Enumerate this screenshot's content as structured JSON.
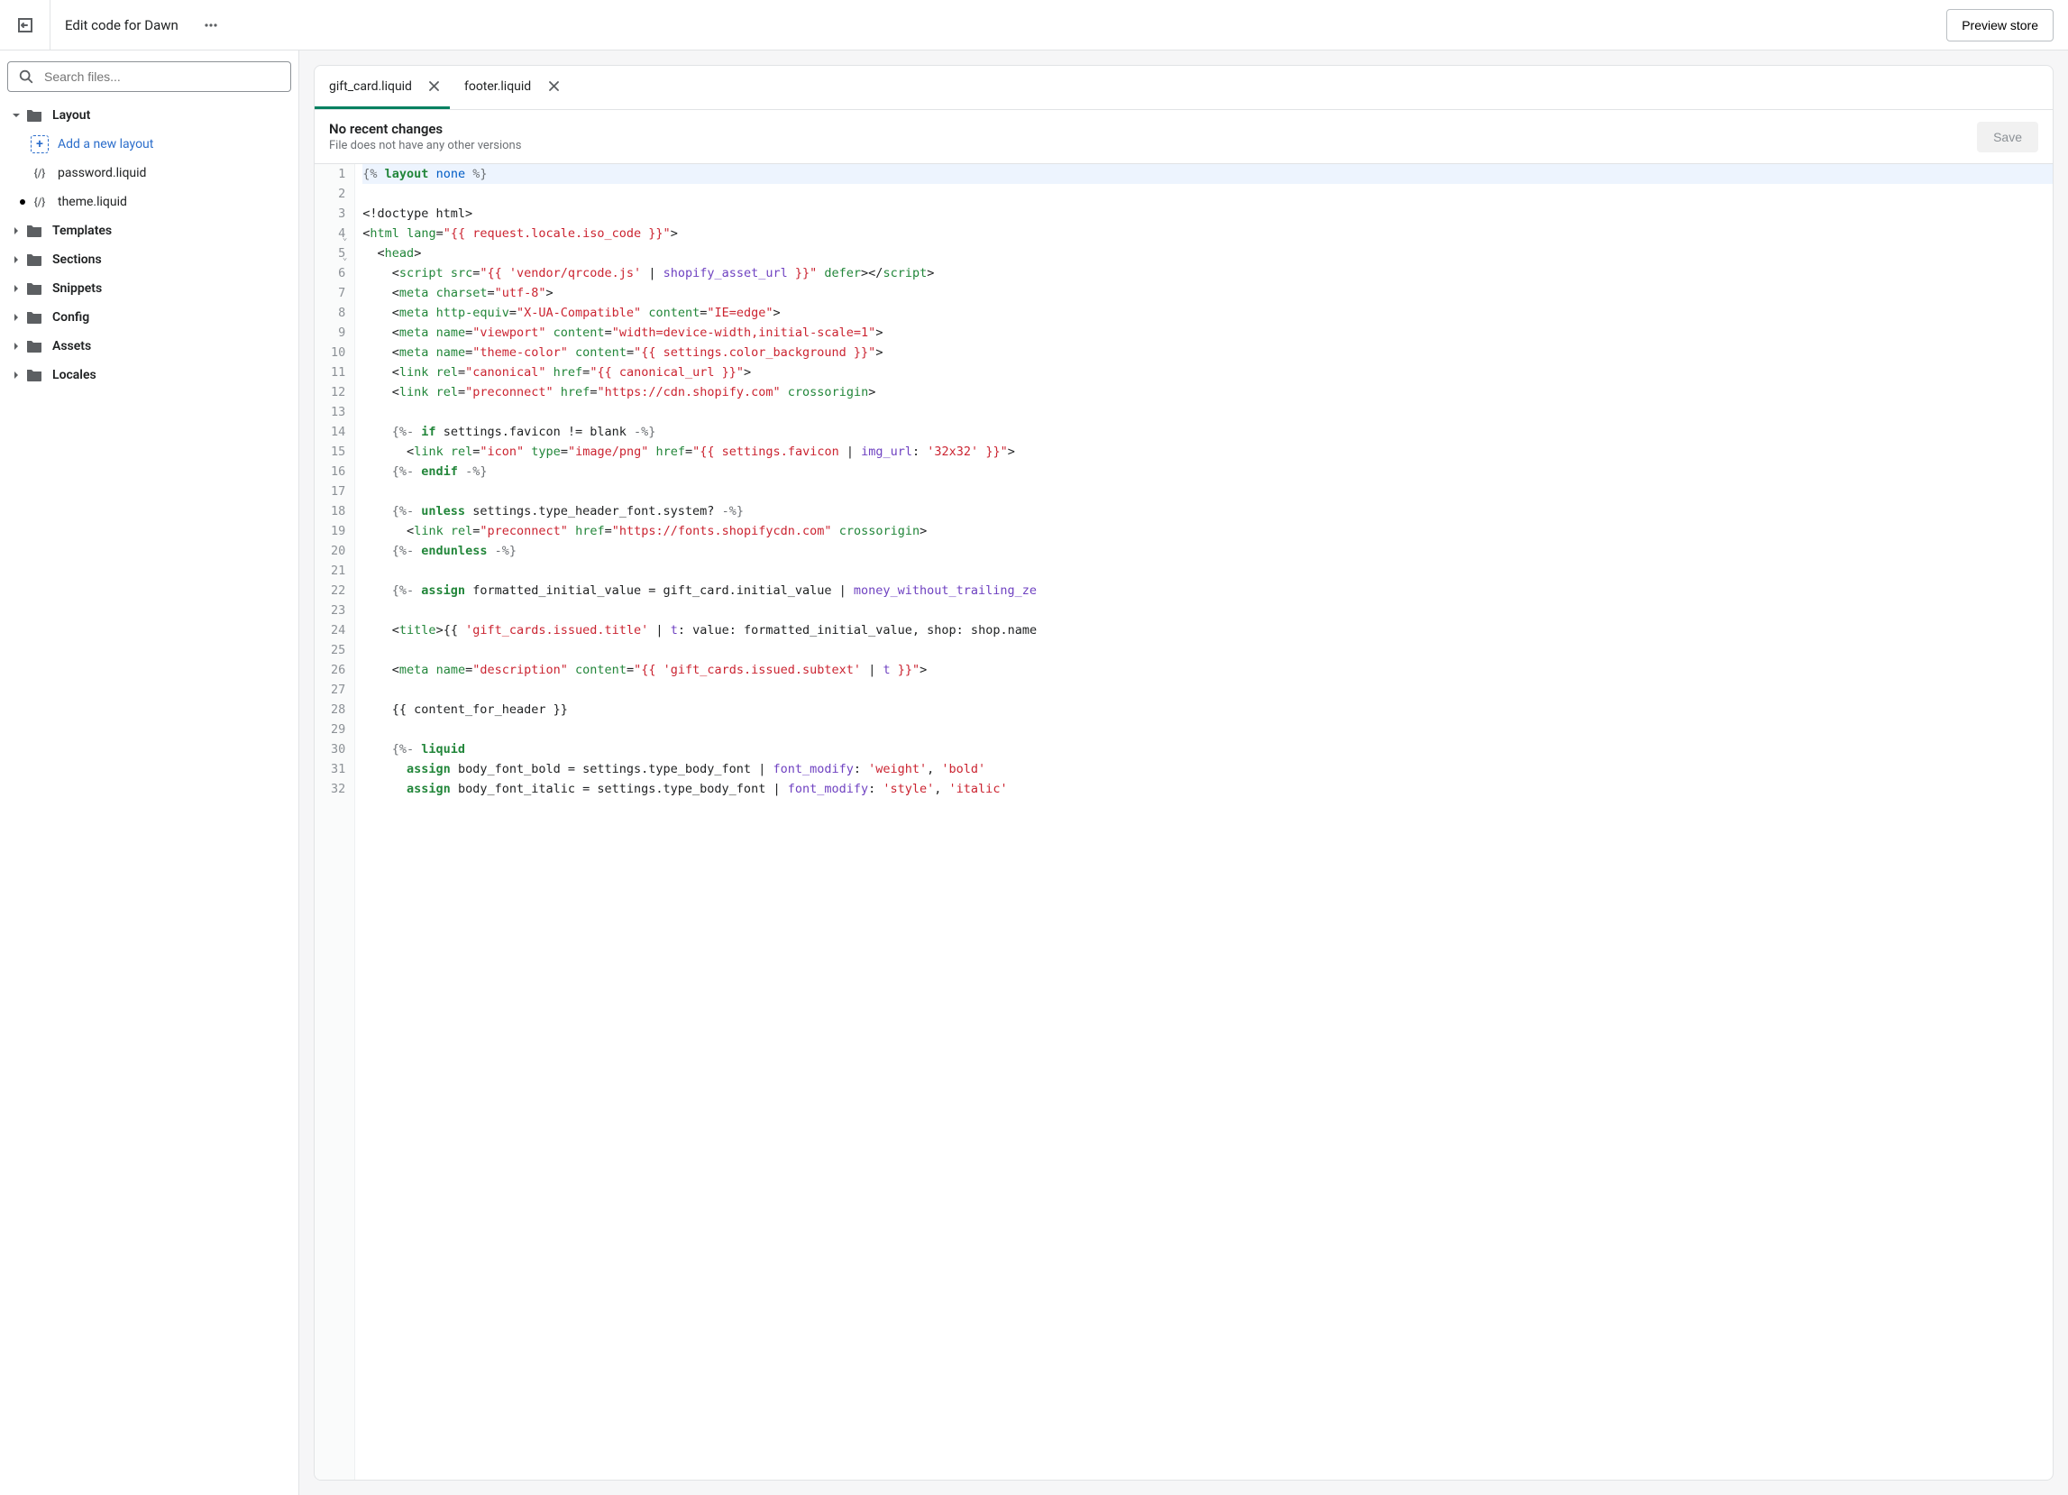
{
  "header": {
    "title": "Edit code for Dawn",
    "preview_label": "Preview store"
  },
  "sidebar": {
    "search_placeholder": "Search files...",
    "folders": [
      {
        "name": "Layout",
        "expanded": true
      },
      {
        "name": "Templates",
        "expanded": false
      },
      {
        "name": "Sections",
        "expanded": false
      },
      {
        "name": "Snippets",
        "expanded": false
      },
      {
        "name": "Config",
        "expanded": false
      },
      {
        "name": "Assets",
        "expanded": false
      },
      {
        "name": "Locales",
        "expanded": false
      }
    ],
    "layout_children": {
      "add_label": "Add a new layout",
      "files": [
        {
          "name": "password.liquid",
          "modified": false
        },
        {
          "name": "theme.liquid",
          "modified": true
        }
      ]
    }
  },
  "tabs": [
    {
      "label": "gift_card.liquid",
      "active": true
    },
    {
      "label": "footer.liquid",
      "active": false
    }
  ],
  "changes": {
    "title": "No recent changes",
    "subtitle": "File does not have any other versions",
    "save_label": "Save"
  },
  "code": {
    "line_count": 32,
    "fold_lines": [
      4,
      5
    ],
    "lines": [
      [
        {
          "c": "t-delim",
          "t": "{% "
        },
        {
          "c": "t-kw",
          "t": "layout"
        },
        {
          "c": "t-plain",
          "t": " "
        },
        {
          "c": "t-none",
          "t": "none"
        },
        {
          "c": "t-delim",
          "t": " %}"
        }
      ],
      [],
      [
        {
          "c": "t-tagbr",
          "t": "<!doctype html>"
        }
      ],
      [
        {
          "c": "t-tagbr",
          "t": "<"
        },
        {
          "c": "t-tag",
          "t": "html"
        },
        {
          "c": "t-plain",
          "t": " "
        },
        {
          "c": "t-attr",
          "t": "lang"
        },
        {
          "c": "t-plain",
          "t": "="
        },
        {
          "c": "t-str",
          "t": "\"{{ request.locale.iso_code }}\""
        },
        {
          "c": "t-tagbr",
          "t": ">"
        }
      ],
      [
        {
          "c": "t-plain",
          "t": "  "
        },
        {
          "c": "t-tagbr",
          "t": "<"
        },
        {
          "c": "t-tag",
          "t": "head"
        },
        {
          "c": "t-tagbr",
          "t": ">"
        }
      ],
      [
        {
          "c": "t-plain",
          "t": "    "
        },
        {
          "c": "t-tagbr",
          "t": "<"
        },
        {
          "c": "t-tag",
          "t": "script"
        },
        {
          "c": "t-plain",
          "t": " "
        },
        {
          "c": "t-attr",
          "t": "src"
        },
        {
          "c": "t-plain",
          "t": "="
        },
        {
          "c": "t-str",
          "t": "\"{{ 'vendor/qrcode.js' "
        },
        {
          "c": "t-plain",
          "t": "| "
        },
        {
          "c": "t-filter",
          "t": "shopify_asset_url"
        },
        {
          "c": "t-str",
          "t": " }}\""
        },
        {
          "c": "t-plain",
          "t": " "
        },
        {
          "c": "t-attr",
          "t": "defer"
        },
        {
          "c": "t-tagbr",
          "t": "></"
        },
        {
          "c": "t-tag",
          "t": "script"
        },
        {
          "c": "t-tagbr",
          "t": ">"
        }
      ],
      [
        {
          "c": "t-plain",
          "t": "    "
        },
        {
          "c": "t-tagbr",
          "t": "<"
        },
        {
          "c": "t-tag",
          "t": "meta"
        },
        {
          "c": "t-plain",
          "t": " "
        },
        {
          "c": "t-attr",
          "t": "charset"
        },
        {
          "c": "t-plain",
          "t": "="
        },
        {
          "c": "t-str",
          "t": "\"utf-8\""
        },
        {
          "c": "t-tagbr",
          "t": ">"
        }
      ],
      [
        {
          "c": "t-plain",
          "t": "    "
        },
        {
          "c": "t-tagbr",
          "t": "<"
        },
        {
          "c": "t-tag",
          "t": "meta"
        },
        {
          "c": "t-plain",
          "t": " "
        },
        {
          "c": "t-attr",
          "t": "http-equiv"
        },
        {
          "c": "t-plain",
          "t": "="
        },
        {
          "c": "t-str",
          "t": "\"X-UA-Compatible\""
        },
        {
          "c": "t-plain",
          "t": " "
        },
        {
          "c": "t-attr",
          "t": "content"
        },
        {
          "c": "t-plain",
          "t": "="
        },
        {
          "c": "t-str",
          "t": "\"IE=edge\""
        },
        {
          "c": "t-tagbr",
          "t": ">"
        }
      ],
      [
        {
          "c": "t-plain",
          "t": "    "
        },
        {
          "c": "t-tagbr",
          "t": "<"
        },
        {
          "c": "t-tag",
          "t": "meta"
        },
        {
          "c": "t-plain",
          "t": " "
        },
        {
          "c": "t-attr",
          "t": "name"
        },
        {
          "c": "t-plain",
          "t": "="
        },
        {
          "c": "t-str",
          "t": "\"viewport\""
        },
        {
          "c": "t-plain",
          "t": " "
        },
        {
          "c": "t-attr",
          "t": "content"
        },
        {
          "c": "t-plain",
          "t": "="
        },
        {
          "c": "t-str",
          "t": "\"width=device-width,initial-scale=1\""
        },
        {
          "c": "t-tagbr",
          "t": ">"
        }
      ],
      [
        {
          "c": "t-plain",
          "t": "    "
        },
        {
          "c": "t-tagbr",
          "t": "<"
        },
        {
          "c": "t-tag",
          "t": "meta"
        },
        {
          "c": "t-plain",
          "t": " "
        },
        {
          "c": "t-attr",
          "t": "name"
        },
        {
          "c": "t-plain",
          "t": "="
        },
        {
          "c": "t-str",
          "t": "\"theme-color\""
        },
        {
          "c": "t-plain",
          "t": " "
        },
        {
          "c": "t-attr",
          "t": "content"
        },
        {
          "c": "t-plain",
          "t": "="
        },
        {
          "c": "t-str",
          "t": "\"{{ settings.color_background }}\""
        },
        {
          "c": "t-tagbr",
          "t": ">"
        }
      ],
      [
        {
          "c": "t-plain",
          "t": "    "
        },
        {
          "c": "t-tagbr",
          "t": "<"
        },
        {
          "c": "t-tag",
          "t": "link"
        },
        {
          "c": "t-plain",
          "t": " "
        },
        {
          "c": "t-attr",
          "t": "rel"
        },
        {
          "c": "t-plain",
          "t": "="
        },
        {
          "c": "t-str",
          "t": "\"canonical\""
        },
        {
          "c": "t-plain",
          "t": " "
        },
        {
          "c": "t-attr",
          "t": "href"
        },
        {
          "c": "t-plain",
          "t": "="
        },
        {
          "c": "t-str",
          "t": "\"{{ canonical_url }}\""
        },
        {
          "c": "t-tagbr",
          "t": ">"
        }
      ],
      [
        {
          "c": "t-plain",
          "t": "    "
        },
        {
          "c": "t-tagbr",
          "t": "<"
        },
        {
          "c": "t-tag",
          "t": "link"
        },
        {
          "c": "t-plain",
          "t": " "
        },
        {
          "c": "t-attr",
          "t": "rel"
        },
        {
          "c": "t-plain",
          "t": "="
        },
        {
          "c": "t-str",
          "t": "\"preconnect\""
        },
        {
          "c": "t-plain",
          "t": " "
        },
        {
          "c": "t-attr",
          "t": "href"
        },
        {
          "c": "t-plain",
          "t": "="
        },
        {
          "c": "t-str",
          "t": "\"https://cdn.shopify.com\""
        },
        {
          "c": "t-plain",
          "t": " "
        },
        {
          "c": "t-attr",
          "t": "crossorigin"
        },
        {
          "c": "t-tagbr",
          "t": ">"
        }
      ],
      [],
      [
        {
          "c": "t-plain",
          "t": "    "
        },
        {
          "c": "t-delim",
          "t": "{%- "
        },
        {
          "c": "t-kw",
          "t": "if"
        },
        {
          "c": "t-plain",
          "t": " settings.favicon != blank "
        },
        {
          "c": "t-delim",
          "t": "-%}"
        }
      ],
      [
        {
          "c": "t-plain",
          "t": "      "
        },
        {
          "c": "t-tagbr",
          "t": "<"
        },
        {
          "c": "t-tag",
          "t": "link"
        },
        {
          "c": "t-plain",
          "t": " "
        },
        {
          "c": "t-attr",
          "t": "rel"
        },
        {
          "c": "t-plain",
          "t": "="
        },
        {
          "c": "t-str",
          "t": "\"icon\""
        },
        {
          "c": "t-plain",
          "t": " "
        },
        {
          "c": "t-attr",
          "t": "type"
        },
        {
          "c": "t-plain",
          "t": "="
        },
        {
          "c": "t-str",
          "t": "\"image/png\""
        },
        {
          "c": "t-plain",
          "t": " "
        },
        {
          "c": "t-attr",
          "t": "href"
        },
        {
          "c": "t-plain",
          "t": "="
        },
        {
          "c": "t-str",
          "t": "\"{{ settings.favicon "
        },
        {
          "c": "t-plain",
          "t": "| "
        },
        {
          "c": "t-filter",
          "t": "img_url"
        },
        {
          "c": "t-plain",
          "t": ": "
        },
        {
          "c": "t-str",
          "t": "'32x32'"
        },
        {
          "c": "t-str",
          "t": " }}\""
        },
        {
          "c": "t-tagbr",
          "t": ">"
        }
      ],
      [
        {
          "c": "t-plain",
          "t": "    "
        },
        {
          "c": "t-delim",
          "t": "{%- "
        },
        {
          "c": "t-kw",
          "t": "endif"
        },
        {
          "c": "t-delim",
          "t": " -%}"
        }
      ],
      [],
      [
        {
          "c": "t-plain",
          "t": "    "
        },
        {
          "c": "t-delim",
          "t": "{%- "
        },
        {
          "c": "t-kw",
          "t": "unless"
        },
        {
          "c": "t-plain",
          "t": " settings.type_header_font.system? "
        },
        {
          "c": "t-delim",
          "t": "-%}"
        }
      ],
      [
        {
          "c": "t-plain",
          "t": "      "
        },
        {
          "c": "t-tagbr",
          "t": "<"
        },
        {
          "c": "t-tag",
          "t": "link"
        },
        {
          "c": "t-plain",
          "t": " "
        },
        {
          "c": "t-attr",
          "t": "rel"
        },
        {
          "c": "t-plain",
          "t": "="
        },
        {
          "c": "t-str",
          "t": "\"preconnect\""
        },
        {
          "c": "t-plain",
          "t": " "
        },
        {
          "c": "t-attr",
          "t": "href"
        },
        {
          "c": "t-plain",
          "t": "="
        },
        {
          "c": "t-str",
          "t": "\"https://fonts.shopifycdn.com\""
        },
        {
          "c": "t-plain",
          "t": " "
        },
        {
          "c": "t-attr",
          "t": "crossorigin"
        },
        {
          "c": "t-tagbr",
          "t": ">"
        }
      ],
      [
        {
          "c": "t-plain",
          "t": "    "
        },
        {
          "c": "t-delim",
          "t": "{%- "
        },
        {
          "c": "t-kw",
          "t": "endunless"
        },
        {
          "c": "t-delim",
          "t": " -%}"
        }
      ],
      [],
      [
        {
          "c": "t-plain",
          "t": "    "
        },
        {
          "c": "t-delim",
          "t": "{%- "
        },
        {
          "c": "t-kw",
          "t": "assign"
        },
        {
          "c": "t-plain",
          "t": " formatted_initial_value = gift_card.initial_value | "
        },
        {
          "c": "t-filter",
          "t": "money_without_trailing_ze"
        }
      ],
      [],
      [
        {
          "c": "t-plain",
          "t": "    "
        },
        {
          "c": "t-tagbr",
          "t": "<"
        },
        {
          "c": "t-tag",
          "t": "title"
        },
        {
          "c": "t-tagbr",
          "t": ">"
        },
        {
          "c": "t-plain",
          "t": "{{ "
        },
        {
          "c": "t-str",
          "t": "'gift_cards.issued.title'"
        },
        {
          "c": "t-plain",
          "t": " | "
        },
        {
          "c": "t-filter",
          "t": "t"
        },
        {
          "c": "t-plain",
          "t": ": value: formatted_initial_value, shop: shop.name"
        }
      ],
      [],
      [
        {
          "c": "t-plain",
          "t": "    "
        },
        {
          "c": "t-tagbr",
          "t": "<"
        },
        {
          "c": "t-tag",
          "t": "meta"
        },
        {
          "c": "t-plain",
          "t": " "
        },
        {
          "c": "t-attr",
          "t": "name"
        },
        {
          "c": "t-plain",
          "t": "="
        },
        {
          "c": "t-str",
          "t": "\"description\""
        },
        {
          "c": "t-plain",
          "t": " "
        },
        {
          "c": "t-attr",
          "t": "content"
        },
        {
          "c": "t-plain",
          "t": "="
        },
        {
          "c": "t-str",
          "t": "\"{{ 'gift_cards.issued.subtext' "
        },
        {
          "c": "t-plain",
          "t": "| "
        },
        {
          "c": "t-filter",
          "t": "t"
        },
        {
          "c": "t-str",
          "t": " }}\""
        },
        {
          "c": "t-tagbr",
          "t": ">"
        }
      ],
      [],
      [
        {
          "c": "t-plain",
          "t": "    {{ content_for_header }}"
        }
      ],
      [],
      [
        {
          "c": "t-plain",
          "t": "    "
        },
        {
          "c": "t-delim",
          "t": "{%- "
        },
        {
          "c": "t-kw",
          "t": "liquid"
        }
      ],
      [
        {
          "c": "t-plain",
          "t": "      "
        },
        {
          "c": "t-kw",
          "t": "assign"
        },
        {
          "c": "t-plain",
          "t": " body_font_bold = settings.type_body_font | "
        },
        {
          "c": "t-filter",
          "t": "font_modify"
        },
        {
          "c": "t-plain",
          "t": ": "
        },
        {
          "c": "t-str",
          "t": "'weight'"
        },
        {
          "c": "t-plain",
          "t": ", "
        },
        {
          "c": "t-str",
          "t": "'bold'"
        }
      ],
      [
        {
          "c": "t-plain",
          "t": "      "
        },
        {
          "c": "t-kw",
          "t": "assign"
        },
        {
          "c": "t-plain",
          "t": " body_font_italic = settings.type_body_font | "
        },
        {
          "c": "t-filter",
          "t": "font_modify"
        },
        {
          "c": "t-plain",
          "t": ": "
        },
        {
          "c": "t-str",
          "t": "'style'"
        },
        {
          "c": "t-plain",
          "t": ", "
        },
        {
          "c": "t-str",
          "t": "'italic'"
        }
      ]
    ]
  }
}
